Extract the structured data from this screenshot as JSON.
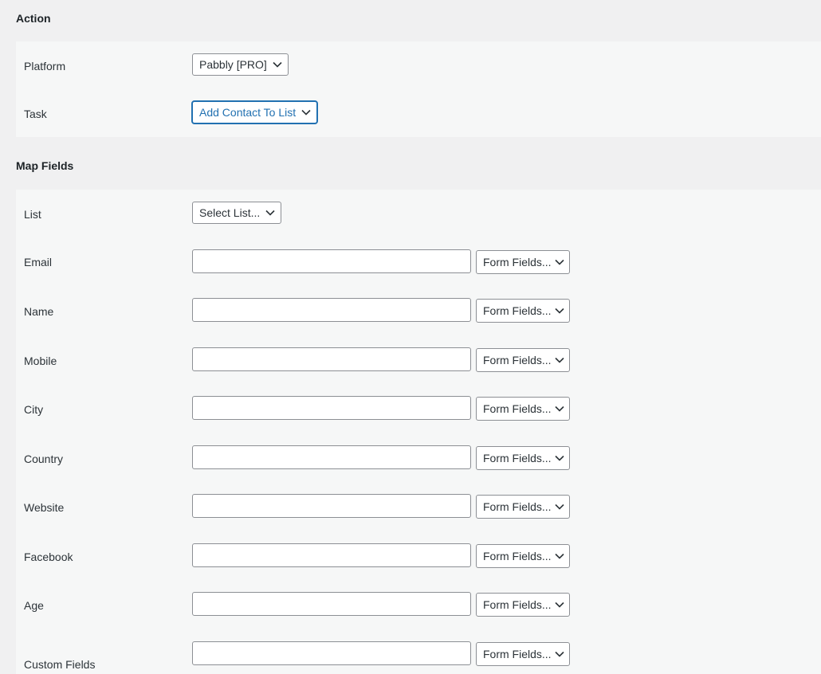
{
  "action": {
    "title": "Action",
    "platform_label": "Platform",
    "platform_value": "Pabbly [PRO]",
    "task_label": "Task",
    "task_value": "Add Contact To List"
  },
  "map_fields": {
    "title": "Map Fields",
    "list_label": "List",
    "list_value": "Select List...",
    "fields": [
      {
        "label": "Email",
        "select": "Form Fields..."
      },
      {
        "label": "Name",
        "select": "Form Fields..."
      },
      {
        "label": "Mobile",
        "select": "Form Fields..."
      },
      {
        "label": "City",
        "select": "Form Fields..."
      },
      {
        "label": "Country",
        "select": "Form Fields..."
      },
      {
        "label": "Website",
        "select": "Form Fields..."
      },
      {
        "label": "Facebook",
        "select": "Form Fields..."
      },
      {
        "label": "Age",
        "select": "Form Fields..."
      },
      {
        "label": "Custom Fields",
        "select": "Form Fields..."
      }
    ]
  },
  "colors": {
    "page_bg": "#f0f0f1",
    "panel_bg": "#f6f7f7",
    "focus_blue": "#2271b1",
    "border": "#8c8f94"
  },
  "icons": {
    "dropdown": "chevron-down-icon"
  }
}
